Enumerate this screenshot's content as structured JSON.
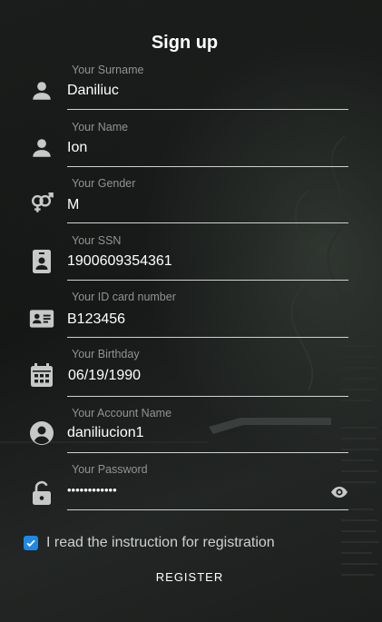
{
  "header": {
    "title": "Sign up"
  },
  "fields": [
    {
      "label": "Your Surname",
      "value": "Daniliuc",
      "icon": "person-icon"
    },
    {
      "label": "Your Name",
      "value": "Ion",
      "icon": "person-icon"
    },
    {
      "label": "Your Gender",
      "value": "M",
      "icon": "gender-icon"
    },
    {
      "label": "Your SSN",
      "value": "1900609354361",
      "icon": "id-badge-icon"
    },
    {
      "label": "Your ID card number",
      "value": "B123456",
      "icon": "id-card-icon"
    },
    {
      "label": "Your Birthday",
      "value": "06/19/1990",
      "icon": "calendar-icon"
    },
    {
      "label": "Your Account Name",
      "value": "daniliucion1",
      "icon": "account-circle-icon"
    },
    {
      "label": "Your Password",
      "value": "••••••••••••",
      "icon": "unlock-icon",
      "toggle_icon": "eye-icon"
    }
  ],
  "agreement": {
    "label": "I read the instruction for registration",
    "checked": true
  },
  "actions": {
    "register_label": "REGISTER"
  },
  "colors": {
    "accent": "#1e88e5",
    "icon": "#c7c9c8",
    "line": "#cfd2d1"
  }
}
